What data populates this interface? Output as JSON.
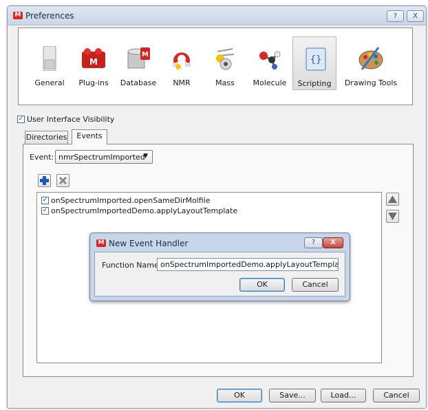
{
  "window": {
    "title": "Preferences",
    "help_label": "?",
    "close_label": "X"
  },
  "toolbar": {
    "items": [
      {
        "label": "General",
        "icon": "general-icon"
      },
      {
        "label": "Plug-ins",
        "icon": "plugins-icon"
      },
      {
        "label": "Database",
        "icon": "database-icon"
      },
      {
        "label": "NMR",
        "icon": "nmr-icon"
      },
      {
        "label": "Mass",
        "icon": "mass-icon"
      },
      {
        "label": "Molecule",
        "icon": "molecule-icon"
      },
      {
        "label": "Scripting",
        "icon": "scripting-icon",
        "selected": true
      },
      {
        "label": "Drawing Tools",
        "icon": "drawing-tools-icon"
      }
    ]
  },
  "ui_visibility": {
    "label": "User Interface Visibility",
    "checked": true
  },
  "tabs": [
    {
      "label": "Directories"
    },
    {
      "label": "Events",
      "active": true
    }
  ],
  "events": {
    "event_label": "Event:",
    "event_value": "nmrSpectrumImported",
    "handlers": [
      {
        "label": "onSpectrumImported.openSameDirMolfile",
        "checked": true
      },
      {
        "label": "onSpectrumImportedDemo.applyLayoutTemplate",
        "checked": true
      }
    ]
  },
  "dialog": {
    "title": "New Event Handler",
    "help_label": "?",
    "close_label": "X",
    "field_label": "Function Name:",
    "field_value": "onSpectrumImportedDemo.applyLayoutTemplate",
    "ok_label": "OK",
    "cancel_label": "Cancel"
  },
  "footer": {
    "ok_label": "OK",
    "save_label": "Save...",
    "load_label": "Load...",
    "cancel_label": "Cancel"
  },
  "colors": {
    "accent_blue": "#3d7bad",
    "brand_red": "#d8251f",
    "window_bg": "#f0f0f0"
  }
}
